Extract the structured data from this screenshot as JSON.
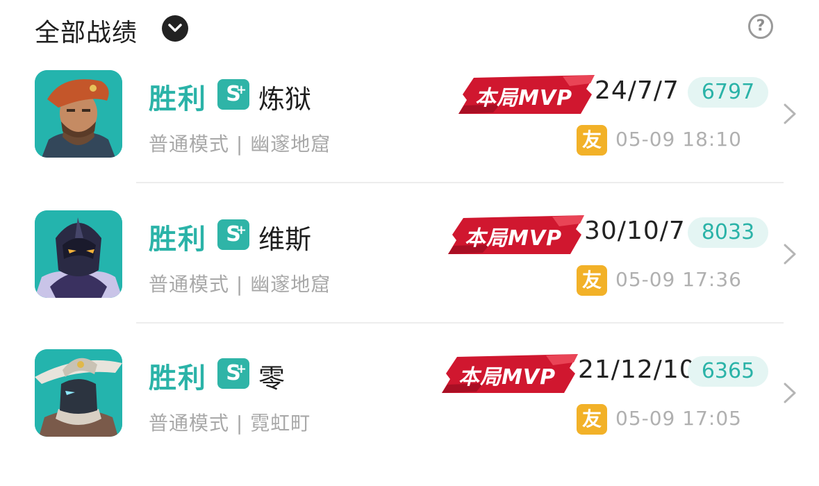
{
  "header": {
    "title": "全部战绩",
    "dropdown_icon": "chevron-down-icon",
    "help_icon": "question-mark-icon",
    "help_label": "?"
  },
  "records": [
    {
      "avatar_icon": "hero-portrait-beret-soldier",
      "result": "胜利",
      "tier": "S",
      "tier_plus": "+",
      "hero": "炼狱",
      "mode": "普通模式 | 幽邃地窟",
      "mvp_label": "本局MVP",
      "kda": "24/7/7",
      "score": "6797",
      "friend_label": "友",
      "datetime": "05-09 18:10"
    },
    {
      "avatar_icon": "hero-portrait-armored-ninja",
      "result": "胜利",
      "tier": "S",
      "tier_plus": "+",
      "hero": "维斯",
      "mode": "普通模式 | 幽邃地窟",
      "mvp_label": "本局MVP",
      "kda": "30/10/7",
      "score": "8033",
      "friend_label": "友",
      "datetime": "05-09 17:36"
    },
    {
      "avatar_icon": "hero-portrait-wide-hat-masked",
      "result": "胜利",
      "tier": "S",
      "tier_plus": "+",
      "hero": "零",
      "mode": "普通模式 | 霓虹町",
      "mvp_label": "本局MVP",
      "kda": "21/12/10",
      "score": "6365",
      "friend_label": "友",
      "datetime": "05-09 17:05"
    }
  ],
  "colors": {
    "accent_teal": "#2bb3a8",
    "mvp_red": "#d0172f",
    "friend_orange": "#f2b128",
    "muted_gray": "#a8a8a8"
  }
}
